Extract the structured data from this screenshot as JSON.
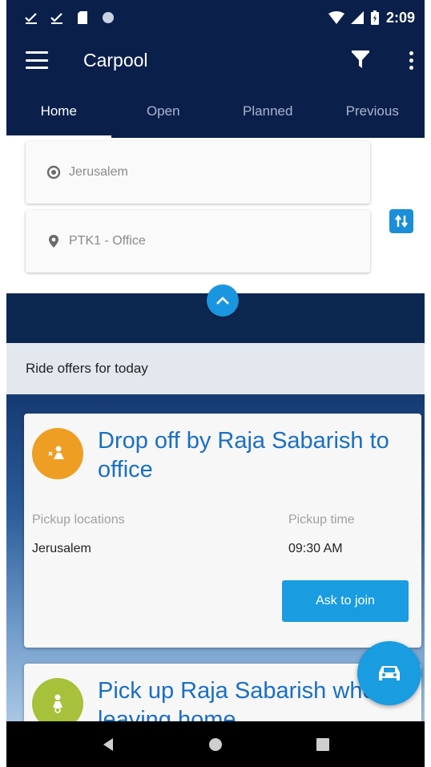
{
  "status_bar": {
    "time": "2:09"
  },
  "app_bar": {
    "title": "Carpool"
  },
  "tabs": [
    {
      "label": "Home",
      "active": true
    },
    {
      "label": "Open",
      "active": false
    },
    {
      "label": "Planned",
      "active": false
    },
    {
      "label": "Previous",
      "active": false
    }
  ],
  "search": {
    "from_value": "Jerusalem",
    "to_value": "PTK1 - Office"
  },
  "section": {
    "title": "Ride offers for today"
  },
  "rides": [
    {
      "title": "Drop off by Raja Sabarish to office",
      "pickup_locations_label": "Pickup locations",
      "pickup_locations_value": "Jerusalem",
      "pickup_time_label": "Pickup time",
      "pickup_time_value": "09:30 AM",
      "action_label": "Ask to join",
      "avatar_color": "#ef9e24"
    },
    {
      "title": "Pick up Raja Sabarish when leaving home",
      "avatar_color": "#a6c13a"
    }
  ],
  "colors": {
    "primary_dark": "#0a1f4a",
    "accent": "#1a9ce0",
    "title_blue": "#1a6fc4"
  }
}
